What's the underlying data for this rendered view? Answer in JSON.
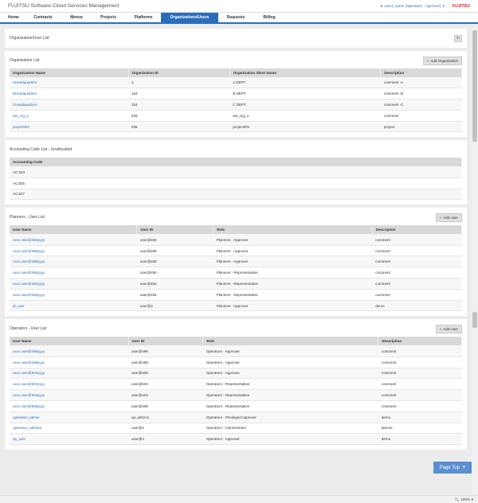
{
  "app_title": "FUJITSU Software Cloud Services Management",
  "user_menu": "user1_name (Operators - Approver)",
  "logo": "FUJITSU",
  "nav": [
    "Home",
    "Contracts",
    "Menus",
    "Projects",
    "Platforms",
    "Organizations/Users",
    "Requests",
    "Billing"
  ],
  "nav_active_index": 5,
  "page_title": "Organization/User List",
  "org_list": {
    "title": "Organization List",
    "button": "Add Organization",
    "columns": [
      "Organization Name",
      "Organization ID",
      "Organization Short Name",
      "Description"
    ],
    "rows": [
      [
        "AHeadquarters",
        "4",
        "A DEPT.",
        "comment -A"
      ],
      [
        "BHeadquarters",
        "164",
        "B DEPT.",
        "comment -B"
      ],
      [
        "CHeadquarters",
        "324",
        "C DEPT.",
        "comment -C"
      ],
      [
        "wd_org_a",
        "529",
        "wd_org_a",
        "comment"
      ],
      [
        "project001",
        "535",
        "project001",
        "project"
      ]
    ]
  },
  "accounting": {
    "title": "Accounting Code List - Unallocated",
    "columns": [
      "Accounting Code"
    ],
    "rows": [
      [
        "AC:523"
      ],
      [
        "AC:525"
      ],
      [
        "AC:527"
      ]
    ]
  },
  "planners": {
    "title": "Planners - User List",
    "button": "Add User",
    "columns": [
      "User Name",
      "User ID",
      "Role",
      "Description"
    ],
    "rows": [
      [
        "xxxx user@484yyyy",
        "user@484",
        "Planners - Approver",
        "comment"
      ],
      [
        "xxxx user@486yyyy",
        "user@486",
        "Planners - Approver",
        "comment"
      ],
      [
        "xxxx user@488yyyy",
        "user@488",
        "Planners - Approver",
        "comment"
      ],
      [
        "xxxx user@490yyyy",
        "user@490",
        "Planners - Representative",
        "comment"
      ],
      [
        "xxxx user@492yyyy",
        "user@492",
        "Planners - Representative",
        "comment"
      ],
      [
        "xxxx user@494yyyy",
        "user@494",
        "Planners - Representative",
        "comment"
      ],
      [
        "pl_user",
        "user@3",
        "Planners - Approver",
        "demo"
      ]
    ]
  },
  "operators": {
    "title": "Operators - User List",
    "button": "Add User",
    "columns": [
      "User Name",
      "User ID",
      "Role",
      "Description"
    ],
    "rows": [
      [
        "xxxx user@496yyyy",
        "user@496",
        "Operators - Approver",
        "comment"
      ],
      [
        "xxxx user@498yyyy",
        "user@498",
        "Operators - Approver",
        "comment"
      ],
      [
        "xxxx user@500yyyy",
        "user@500",
        "Operators - Approver",
        "comment"
      ],
      [
        "xxxx user@502yyyy",
        "user@502",
        "Operators - Representative",
        "comment"
      ],
      [
        "xxxx user@504yyyy",
        "user@504",
        "Operators - Representative",
        "comment"
      ],
      [
        "xxxx user@506yyyy",
        "user@506",
        "Operators - Representative",
        "comment"
      ],
      [
        "operation_admin",
        "op_admin1",
        "Operators - Privileged Approver",
        "demo"
      ],
      [
        "operation_admin2",
        "user@2",
        "Operators - Administrator",
        "demo2"
      ],
      [
        "op_user",
        "user@4",
        "Operators - Approver",
        "demo"
      ]
    ]
  },
  "page_top": "Page Top",
  "zoom": "100%",
  "colors": {
    "accent": "#2a6ebb",
    "brand": "#e60012",
    "page_top_bg": "#5b8fd1"
  }
}
